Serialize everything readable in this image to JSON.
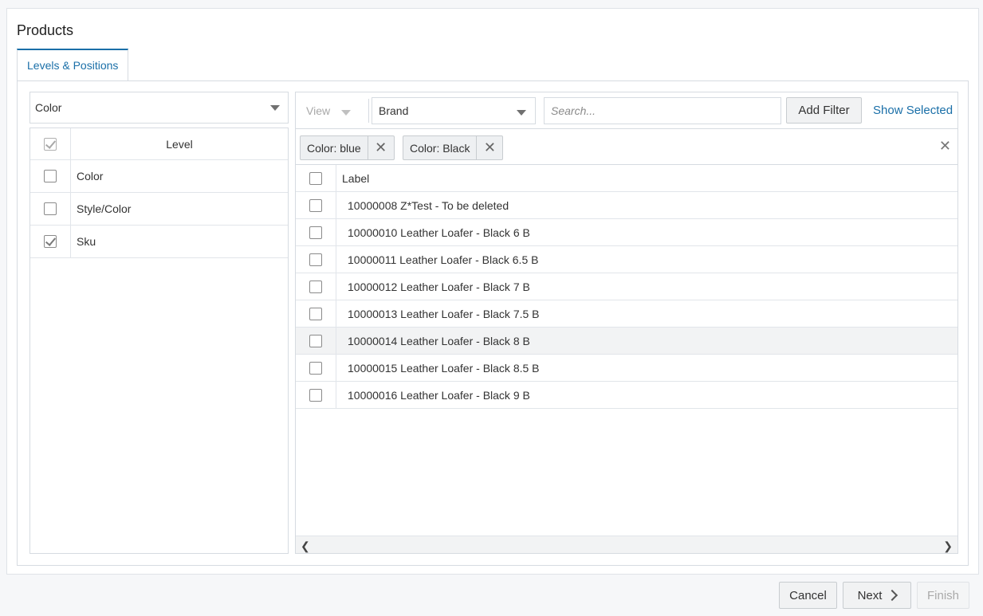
{
  "page": {
    "title": "Products"
  },
  "tabs": [
    {
      "label": "Levels & Positions"
    }
  ],
  "left": {
    "select_value": "Color",
    "header": "Level",
    "rows": [
      {
        "label": "Color",
        "checked": false
      },
      {
        "label": "Style/Color",
        "checked": false
      },
      {
        "label": "Sku",
        "checked": true
      }
    ]
  },
  "toolbar": {
    "view_label": "View",
    "brand_value": "Brand",
    "search_placeholder": "Search...",
    "add_filter_label": "Add Filter",
    "show_selected_label": "Show Selected"
  },
  "filters": [
    {
      "label": "Color: blue"
    },
    {
      "label": "Color: Black"
    }
  ],
  "grid": {
    "header": "Label",
    "rows": [
      "10000008 Z*Test - To be deleted",
      "10000010 Leather Loafer - Black 6 B",
      "10000011 Leather Loafer - Black 6.5 B",
      "10000012 Leather Loafer - Black 7 B",
      "10000013 Leather Loafer - Black 7.5 B",
      "10000014 Leather Loafer - Black 8 B",
      "10000015 Leather Loafer - Black 8.5 B",
      "10000016 Leather Loafer - Black 9 B"
    ]
  },
  "footer": {
    "cancel_label": "Cancel",
    "next_label": "Next",
    "finish_label": "Finish"
  },
  "colors": {
    "accent": "#1a6fa8",
    "border": "#d6dbe1"
  }
}
